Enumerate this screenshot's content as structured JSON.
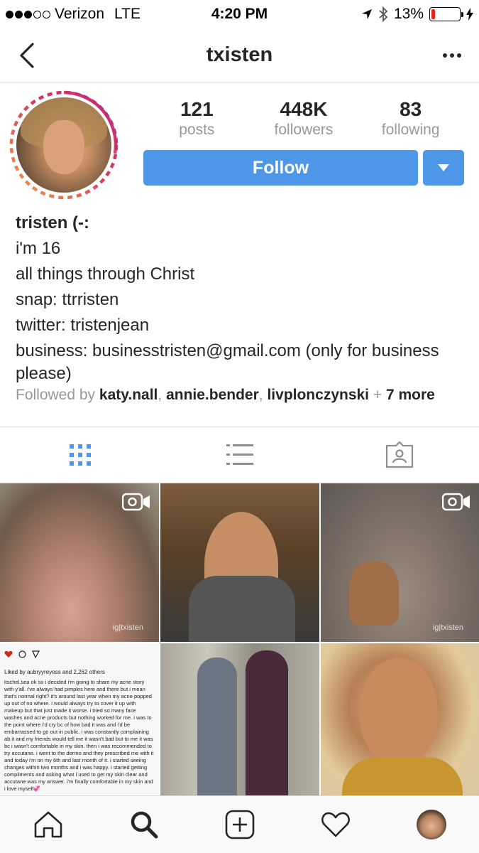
{
  "status_bar": {
    "carrier": "Verizon",
    "network": "LTE",
    "time": "4:20 PM",
    "battery": "13%",
    "battery_level": 0.13,
    "colors": {
      "battery_low": "#e0241b"
    }
  },
  "header": {
    "title": "txisten"
  },
  "profile": {
    "stats": [
      {
        "value": "121",
        "label": "posts"
      },
      {
        "value": "448K",
        "label": "followers"
      },
      {
        "value": "83",
        "label": "following"
      }
    ],
    "follow_label": "Follow",
    "name": "tristen (-:",
    "bio_lines": [
      "i'm 16",
      "all things through Christ",
      "snap: ttrristen",
      "twitter: tristenjean",
      "business: businesstristen@gmail.com (only for business please)"
    ],
    "followed_by": {
      "prefix": "Followed by",
      "users": [
        "katy.nall",
        "annie.bender",
        "livplonczynski"
      ],
      "sep": ",",
      "plus": "+",
      "more": "7 more"
    }
  },
  "colors": {
    "accent": "#4e96e8",
    "text": "#262626",
    "muted": "#999999",
    "divider": "#dbdbdb"
  },
  "grid": {
    "watermark": "ig|txisten",
    "post4": {
      "likes": "Liked by aubryyreyess and 2,262 others",
      "caption": "itschel.sea ok so i decided i'm going to share my acne story with y'all. i've always had pimples here and there but i mean that's normal right? it's around last year when my acne popped up out of no where. i would always try to cover it up with makeup but that just made it worse. i tried so many face washes and acne products but nothing worked for me. i was to the point where i'd cry bc of how bad it was and i'd be embarrassed to go out in public. i was constantly complaining ab it and my friends would tell me it wasn't bad but to me it was bc i wasn't comfortable in my skin. then i was recommended to try accutane. i went to the dermo and they prescribed me with it and today i'm on my 6th and last month of it. i started seeing changes within two months and i was happy. i started getting compliments and asking what i used to get my skin clear and accutane was my answer. i'm finally comfortable in my skin and i love myself💞"
    }
  }
}
